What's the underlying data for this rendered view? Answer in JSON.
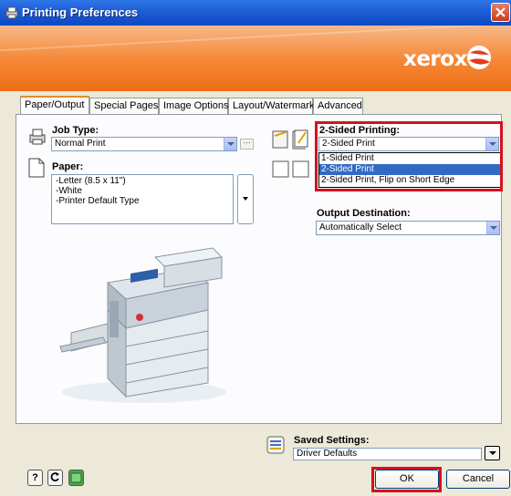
{
  "window": {
    "title": "Printing Preferences"
  },
  "brand": {
    "logo": "xerox",
    "accent": "#f58a3a",
    "title_blue": "#0b48c4",
    "highlight_red": "#d4111f"
  },
  "tabs": [
    {
      "label": "Paper/Output",
      "active": true
    },
    {
      "label": "Special Pages",
      "active": false
    },
    {
      "label": "Image Options",
      "active": false
    },
    {
      "label": "Layout/Watermark",
      "active": false
    },
    {
      "label": "Advanced",
      "active": false
    }
  ],
  "job_type": {
    "label": "Job Type:",
    "value": "Normal Print",
    "icon": "printer-icon"
  },
  "paper": {
    "label": "Paper:",
    "lines": [
      "-Letter (8.5 x 11\")",
      "-White",
      "-Printer Default Type"
    ],
    "icon": "paper-page-icon"
  },
  "two_sided": {
    "label": "2-Sided Printing:",
    "value": "2-Sided Print",
    "options": [
      "1-Sided Print",
      "2-Sided Print",
      "2-Sided Print, Flip on Short Edge"
    ],
    "selected_index": 1
  },
  "output_destination": {
    "label": "Output Destination:",
    "value": "Automatically Select"
  },
  "saved_settings": {
    "label": "Saved Settings:",
    "value": "Driver Defaults"
  },
  "buttons": {
    "ok": "OK",
    "cancel": "Cancel",
    "help": "?",
    "restore": "↺"
  }
}
